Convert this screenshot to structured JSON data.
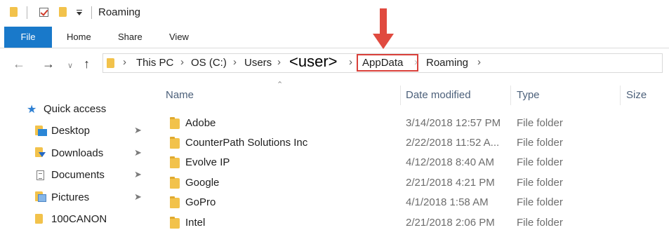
{
  "window": {
    "title": "Roaming"
  },
  "ribbon": {
    "tabs": [
      "File",
      "Home",
      "Share",
      "View"
    ]
  },
  "address": {
    "crumbs": [
      "This PC",
      "OS (C:)",
      "Users",
      "<user>",
      "AppData",
      "Roaming"
    ],
    "highlighted": "AppData"
  },
  "nav": {
    "quick_access": "Quick access",
    "items": [
      {
        "label": "Desktop",
        "icon": "desktop-icon",
        "pinned": true
      },
      {
        "label": "Downloads",
        "icon": "downloads-icon",
        "pinned": true
      },
      {
        "label": "Documents",
        "icon": "documents-icon",
        "pinned": true
      },
      {
        "label": "Pictures",
        "icon": "pictures-icon",
        "pinned": true
      },
      {
        "label": "100CANON",
        "icon": "folder-icon",
        "pinned": false
      }
    ]
  },
  "columns": {
    "name": "Name",
    "date": "Date modified",
    "type": "Type",
    "size": "Size"
  },
  "files": [
    {
      "name": "Adobe",
      "date": "3/14/2018 12:57 PM",
      "type": "File folder"
    },
    {
      "name": "CounterPath Solutions Inc",
      "date": "2/22/2018 11:52 A...",
      "type": "File folder"
    },
    {
      "name": "Evolve IP",
      "date": "4/12/2018 8:40 AM",
      "type": "File folder"
    },
    {
      "name": "Google",
      "date": "2/21/2018 4:21 PM",
      "type": "File folder"
    },
    {
      "name": "GoPro",
      "date": "4/1/2018 1:58 AM",
      "type": "File folder"
    },
    {
      "name": "Intel",
      "date": "2/21/2018 2:06 PM",
      "type": "File folder"
    }
  ],
  "colors": {
    "accent": "#1979ca",
    "annotation": "#e04a3f",
    "folder": "#f2c24b"
  }
}
